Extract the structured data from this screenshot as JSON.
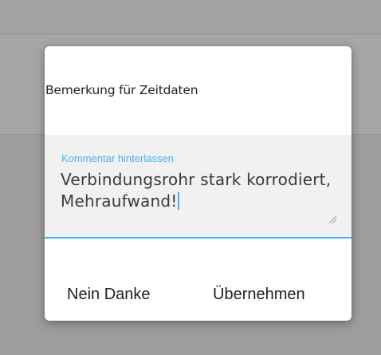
{
  "dialog": {
    "title": "Bemerkung für Zeitdaten",
    "comment_field": {
      "label": "Kommentar hinterlassen",
      "value": "Verbindungsrohr stark korrodiert, Mehraufwand!"
    },
    "buttons": {
      "cancel_label": "Nein Danke",
      "apply_label": "Übernehmen"
    }
  },
  "colors": {
    "accent": "#44b4e4",
    "field_background": "#f1f1f1",
    "dialog_background": "#ffffff",
    "overlay_background": "#9a9a9a"
  },
  "icons": {
    "resize": "resize-handle-icon"
  }
}
